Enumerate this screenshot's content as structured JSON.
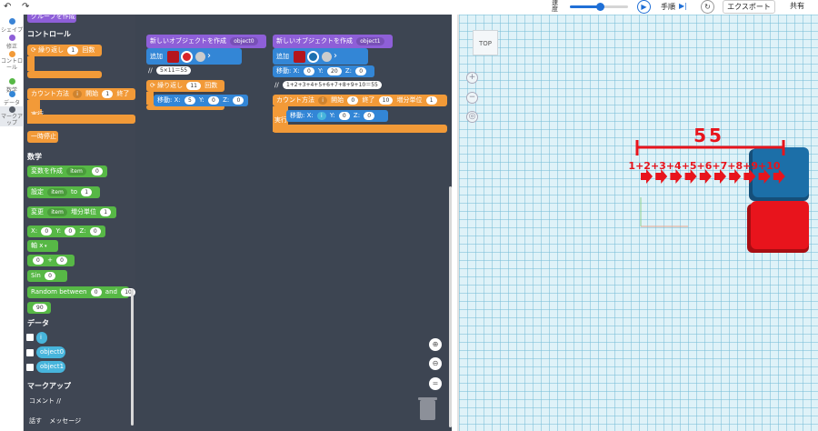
{
  "toolbar": {
    "undo_icon": "undo-arrow-icon",
    "redo_icon": "redo-arrow-icon",
    "speed_label": "速度",
    "speed_fraction": 0.52,
    "play_icon": "play-icon",
    "step_label": "手順",
    "step_icon": "step-forward-icon",
    "reset_icon": "reset-icon",
    "export_label": "エクスポート",
    "share_label": "共有"
  },
  "categories": [
    {
      "label": "シェイプ",
      "color": "#3b84d6"
    },
    {
      "label": "修正",
      "color": "#8e5fd8"
    },
    {
      "label": "コントロール",
      "color": "#f29a38"
    },
    {
      "label": "数学",
      "color": "#57b846"
    },
    {
      "label": "データ",
      "color": "#3386d6"
    },
    {
      "label": "マークアップ",
      "color": "#555b66"
    }
  ],
  "flyout": {
    "group_create": "グループを作成",
    "control_title": "コントロール",
    "repeat_label": "繰り返し",
    "repeat_value": "1",
    "repeat_unit": "回数",
    "count_label": "カウント方法",
    "count_var": "i",
    "count_start_label": "開始",
    "count_start": "1",
    "count_end_label": "終了",
    "exec_label": "実行",
    "pause_label": "一時停止",
    "math_title": "数学",
    "create_var_label": "変数を作成",
    "create_var_name": "item",
    "create_var_value": "0",
    "set_label": "設定",
    "set_var": "item",
    "set_to": "to",
    "set_value": "1",
    "change_label": "変更",
    "change_var": "item",
    "change_by_label": "増分単位",
    "change_value": "1",
    "xyz_x_label": "X:",
    "xyz_x": "0",
    "xyz_y_label": "Y:",
    "xyz_y": "0",
    "xyz_z_label": "Z:",
    "xyz_z": "0",
    "axis_label": "軸 x",
    "arith_a": "0",
    "arith_op": "+",
    "arith_b": "0",
    "sin_label": "Sin",
    "sin_value": "0",
    "random_label": "Random between",
    "random_a": "0",
    "random_and": "and",
    "random_b": "10",
    "angle_value": "90",
    "data_title": "データ",
    "data_vars": [
      "i",
      "object0",
      "object1"
    ],
    "markup_title": "マークアップ",
    "comment_label": "コメント //",
    "speak_label": "話す",
    "message_label": "メッセージ"
  },
  "workspace": {
    "stack0": {
      "create_label": "新しいオブジェクトを作成",
      "object_name": "object0",
      "add_label": "追加",
      "color_shape": "#d8232a",
      "comment_prefix": "//",
      "comment": "5×11＝55",
      "repeat_label": "繰り返し",
      "repeat_value": "11",
      "repeat_unit": "回数",
      "move_label": "移動:",
      "x_label": "X:",
      "x": "5",
      "y_label": "Y:",
      "y": "0",
      "z_label": "Z:",
      "z": "0"
    },
    "stack1": {
      "create_label": "新しいオブジェクトを作成",
      "object_name": "object1",
      "add_label": "追加",
      "color_shape": "#1a6fb0",
      "move_label": "移動:",
      "x_label": "X:",
      "x": "0",
      "y_label": "Y:",
      "y": "20",
      "z_label": "Z:",
      "z": "0",
      "comment_prefix": "//",
      "comment": "1+2+3+4+5+6+7+8+9+10＝55",
      "count_label": "カウント方法",
      "count_var": "i",
      "count_start_label": "開始",
      "count_start": "0",
      "count_end_label": "終了",
      "count_end": "10",
      "count_step_label": "増分単位",
      "count_step": "1",
      "exec_label": "実行",
      "move2_label": "移動:",
      "x2_label": "X:",
      "x2": "i",
      "y2_label": "Y:",
      "y2": "0",
      "z2_label": "Z:",
      "z2": "0"
    },
    "zoom_in_icon": "zoom-in-icon",
    "zoom_out_icon": "zoom-out-icon",
    "zoom_reset_icon": "zoom-reset-icon",
    "trash_icon": "trash-icon"
  },
  "viewport": {
    "view_cube": "TOP",
    "home_icon": "home-icon",
    "zoom_in_icon": "plus-icon",
    "zoom_out_icon": "minus-icon",
    "fit_icon": "fit-view-icon",
    "total_label": "55",
    "sum_label": "1+2+3+4+5+6+7+8+9+10",
    "arrow_count": 10,
    "colors": {
      "red": "#e8141c",
      "blue": "#1c6fa8"
    }
  }
}
